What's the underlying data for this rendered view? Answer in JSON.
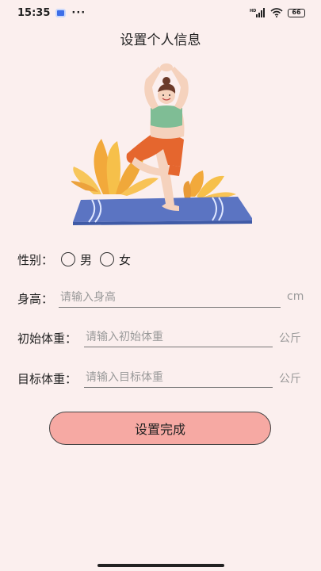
{
  "status_bar": {
    "time": "15:35",
    "dots": "···",
    "network": "HD",
    "battery": "66"
  },
  "page": {
    "title": "设置个人信息"
  },
  "form": {
    "gender": {
      "label": "性别：",
      "option_male": "男",
      "option_female": "女"
    },
    "height": {
      "label": "身高：",
      "placeholder": "请输入身高",
      "unit": "cm"
    },
    "initial_weight": {
      "label": "初始体重：",
      "placeholder": "请输入初始体重",
      "unit": "公斤"
    },
    "target_weight": {
      "label": "目标体重：",
      "placeholder": "请输入目标体重",
      "unit": "公斤"
    },
    "submit_label": "设置完成"
  },
  "colors": {
    "background": "#fbefee",
    "button": "#f6a9a3",
    "mat": "#5b74c2"
  }
}
